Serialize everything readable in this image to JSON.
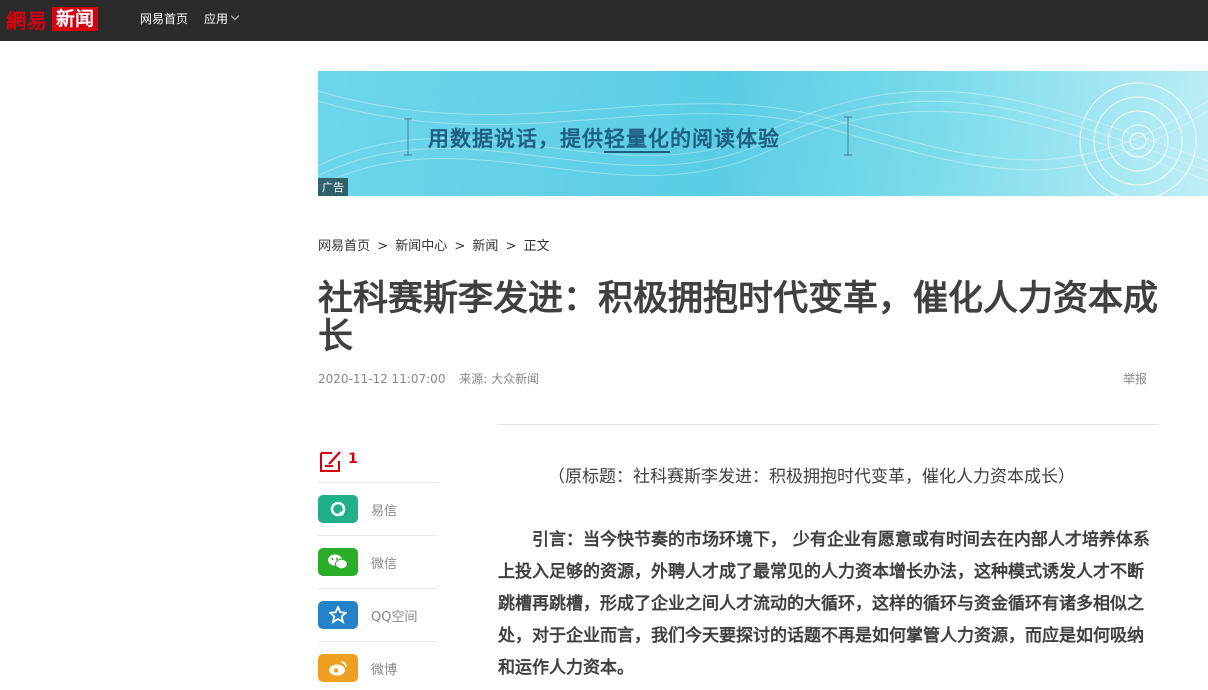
{
  "header": {
    "logo_brand": "網易",
    "logo_news": "新闻",
    "nav": [
      {
        "label": "网易首页"
      },
      {
        "label": "应用"
      }
    ]
  },
  "banner": {
    "text_before": "用数据说话，提供",
    "text_highlight": "轻量化",
    "text_after": "的阅读体验",
    "ad_label": "广告"
  },
  "breadcrumb": {
    "items": [
      "网易首页",
      "新闻中心",
      "新闻",
      "正文"
    ],
    "separator": ">"
  },
  "article": {
    "title": "社科赛斯李发进：积极拥抱时代变革，催化人力资本成长",
    "datetime": "2020-11-12 11:07:00",
    "source": "来源: 大众新闻",
    "report_label": "举报",
    "original_title": "（原标题：社科赛斯李发进：积极拥抱时代变革，催化人力资本成长）",
    "lead": "引言：当今快节奏的市场环境下， 少有企业有愿意或有时间去在内部人才培养体系上投入足够的资源，外聘人才成了最常见的人力资本增长办法，这种模式诱发人才不断跳槽再跳槽，形成了企业之间人才流动的大循环，这样的循环与资金循环有诸多相似之处，对于企业而言，我们今天要探讨的话题不再是如何掌管人力资源，而应是如何吸纳和运作人力资本。"
  },
  "share": {
    "comment_count": "1",
    "items": [
      {
        "label": "易信",
        "color": "#1fb08a",
        "icon": "yixin-icon"
      },
      {
        "label": "微信",
        "color": "#2aae2a",
        "icon": "wechat-icon"
      },
      {
        "label": "QQ空间",
        "color": "#2382c8",
        "icon": "qzone-icon"
      },
      {
        "label": "微博",
        "color": "#f0a020",
        "icon": "weibo-icon"
      }
    ]
  },
  "colors": {
    "brand_red": "#d7000f",
    "topbar_bg": "#2b2b2b"
  }
}
